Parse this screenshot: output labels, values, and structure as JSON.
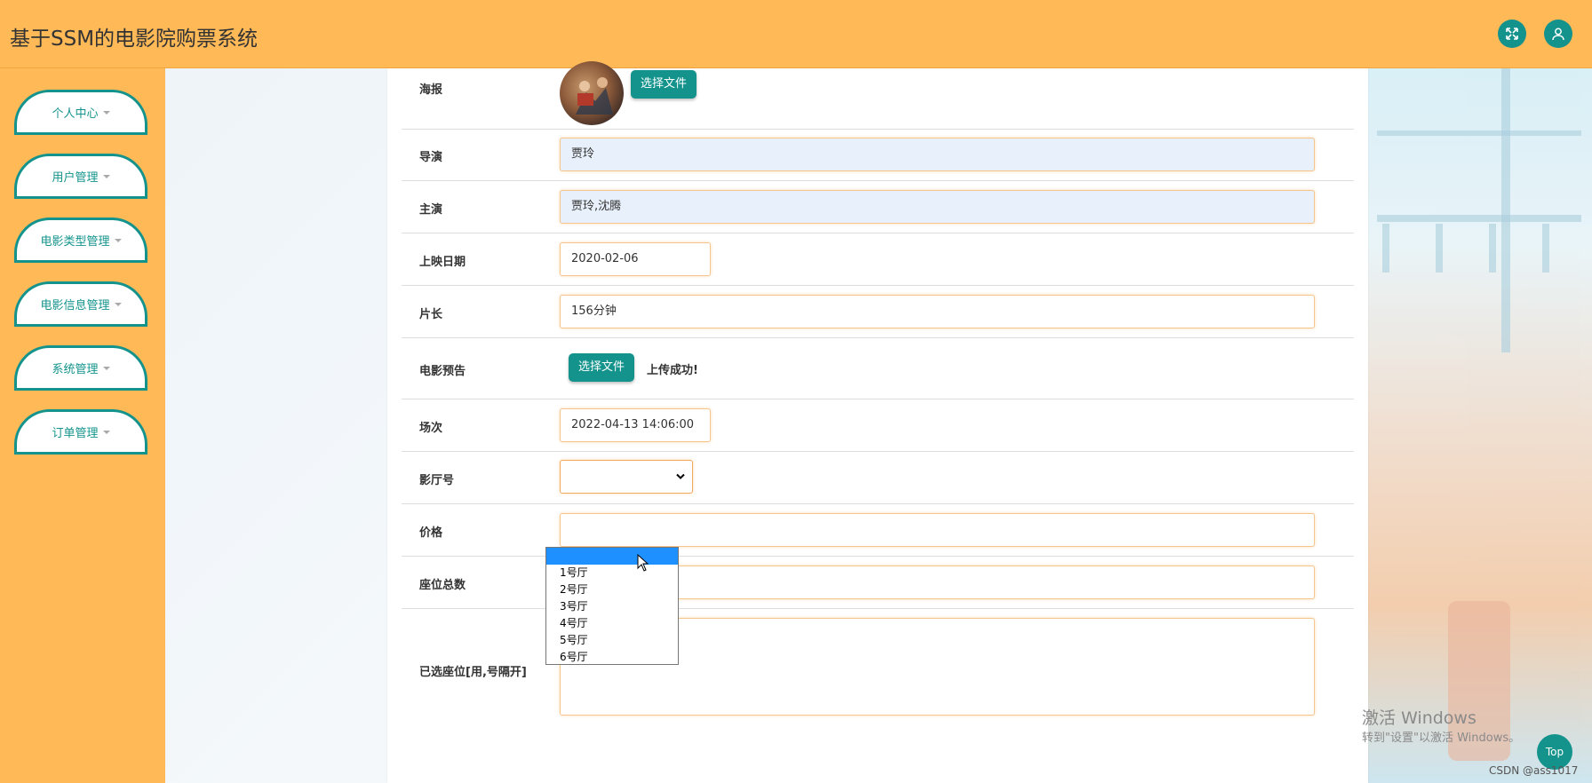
{
  "app": {
    "title": "基于SSM的电影院购票系统"
  },
  "header": {
    "icons": [
      "fullscreen-icon",
      "user-icon"
    ]
  },
  "sidebar": {
    "items": [
      {
        "label": "个人中心"
      },
      {
        "label": "用户管理"
      },
      {
        "label": "电影类型管理"
      },
      {
        "label": "电影信息管理"
      },
      {
        "label": "系统管理"
      },
      {
        "label": "订单管理"
      }
    ]
  },
  "form": {
    "poster": {
      "label": "海报",
      "button": "选择文件"
    },
    "director": {
      "label": "导演",
      "value": "贾玲"
    },
    "actors": {
      "label": "主演",
      "value": "贾玲,沈腾"
    },
    "release_date": {
      "label": "上映日期",
      "value": "2020-02-06"
    },
    "duration": {
      "label": "片长",
      "value": "156分钟"
    },
    "trailer": {
      "label": "电影预告",
      "button": "选择文件",
      "status": "上传成功!"
    },
    "showtime": {
      "label": "场次",
      "value": "2022-04-13 14:06:00"
    },
    "hall": {
      "label": "影厅号",
      "value": ""
    },
    "price": {
      "label": "价格"
    },
    "seats_total": {
      "label": "座位总数"
    },
    "selected_seats": {
      "label": "已选座位[用,号隔开]"
    }
  },
  "hall_dropdown": {
    "options": [
      "",
      "1号厅",
      "2号厅",
      "3号厅",
      "4号厅",
      "5号厅",
      "6号厅"
    ],
    "selected_index": 0
  },
  "overlay": {
    "watermark_title": "激活 Windows",
    "watermark_sub": "转到\"设置\"以激活 Windows。",
    "top_button": "Top",
    "credit": "CSDN @ass1017"
  },
  "colors": {
    "accent": "#13938c",
    "header": "#ffb957"
  }
}
